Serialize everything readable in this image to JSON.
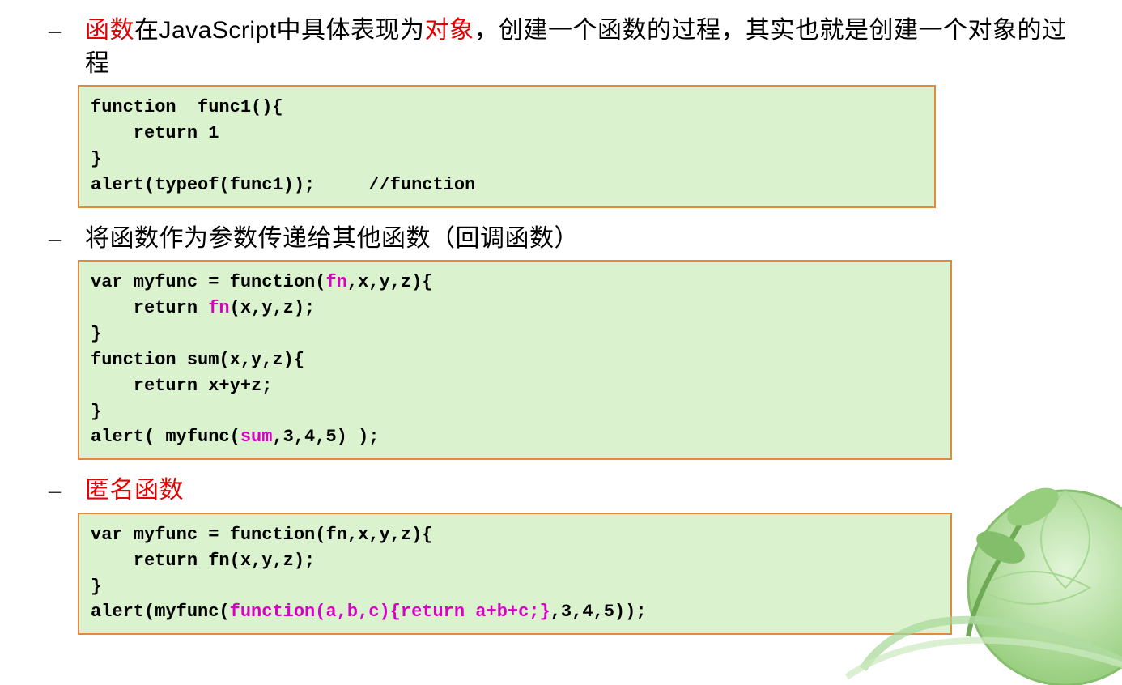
{
  "sections": [
    {
      "bullet": "–",
      "text_parts": [
        {
          "t": "函数",
          "cls": "red"
        },
        {
          "t": "在JavaScript中具体表现为",
          "cls": ""
        },
        {
          "t": "对象",
          "cls": "red"
        },
        {
          "t": "，创建一个函数的过程，其实也就是创建一个对象的过程",
          "cls": ""
        }
      ],
      "code_lines": [
        [
          {
            "t": "function  func1(){",
            "cls": ""
          }
        ],
        [
          {
            "t": "    return 1",
            "cls": ""
          }
        ],
        [
          {
            "t": "}",
            "cls": ""
          }
        ],
        [
          {
            "t": "alert(typeof(func1));     //function",
            "cls": ""
          }
        ]
      ]
    },
    {
      "bullet": "–",
      "text_parts": [
        {
          "t": "将函数作为参数传递给其他函数（回调函数）",
          "cls": ""
        }
      ],
      "code_lines": [
        [
          {
            "t": "var myfunc = function(",
            "cls": ""
          },
          {
            "t": "fn",
            "cls": "kw-pink"
          },
          {
            "t": ",x,y,z){",
            "cls": ""
          }
        ],
        [
          {
            "t": "    return ",
            "cls": ""
          },
          {
            "t": "fn",
            "cls": "kw-pink"
          },
          {
            "t": "(x,y,z);",
            "cls": ""
          }
        ],
        [
          {
            "t": "}",
            "cls": ""
          }
        ],
        [
          {
            "t": "function sum(x,y,z){",
            "cls": ""
          }
        ],
        [
          {
            "t": "    return x+y+z;",
            "cls": ""
          }
        ],
        [
          {
            "t": "}",
            "cls": ""
          }
        ],
        [
          {
            "t": "alert( myfunc(",
            "cls": ""
          },
          {
            "t": "sum",
            "cls": "kw-pink"
          },
          {
            "t": ",3,4,5) );",
            "cls": ""
          }
        ]
      ]
    },
    {
      "bullet": "–",
      "text_parts": [
        {
          "t": "匿名函数",
          "cls": "red"
        }
      ],
      "code_lines": [
        [
          {
            "t": "var myfunc = function(fn,x,y,z){",
            "cls": ""
          }
        ],
        [
          {
            "t": "    return fn(x,y,z);",
            "cls": ""
          }
        ],
        [
          {
            "t": "}",
            "cls": ""
          }
        ],
        [
          {
            "t": "alert(myfunc(",
            "cls": ""
          },
          {
            "t": "function(a,b,c){return a+b+c;}",
            "cls": "kw-pink"
          },
          {
            "t": ",3,4,5));",
            "cls": ""
          }
        ]
      ]
    }
  ]
}
